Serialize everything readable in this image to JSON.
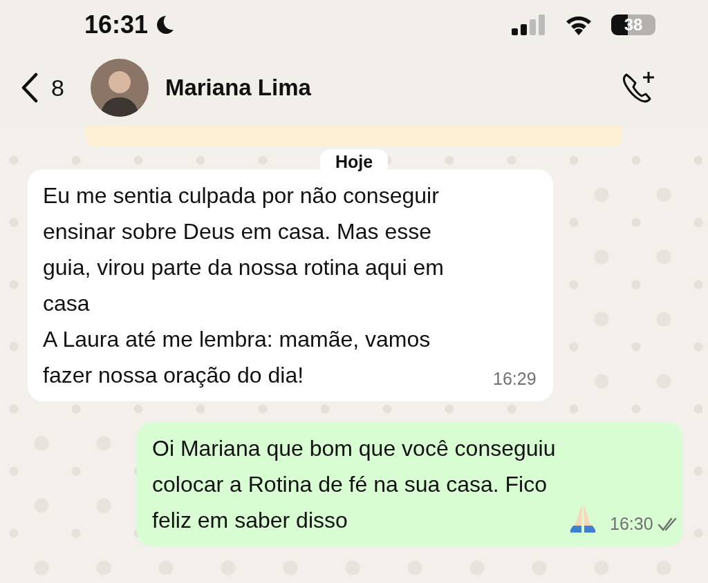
{
  "status_bar": {
    "time": "16:31",
    "focus_mode": true,
    "battery": "38"
  },
  "header": {
    "back_count": "8",
    "contact_name": "Mariana Lima"
  },
  "date_chip": "Hoje",
  "messages": [
    {
      "kind": "incoming",
      "text": "Eu me sentia culpada por não conseguir ensinar sobre Deus em casa. Mas esse guia, virou parte da nossa rotina aqui em casa\nA Laura até me lembra: mamãe, vamos fazer nossa oração do dia!",
      "time": "16:29"
    },
    {
      "kind": "outgoing",
      "text": "Oi Mariana que bom que você conseguiu colocar a Rotina de fé na sua casa. Fico feliz em saber disso",
      "emoji": true,
      "time": "16:30",
      "read": false
    }
  ]
}
